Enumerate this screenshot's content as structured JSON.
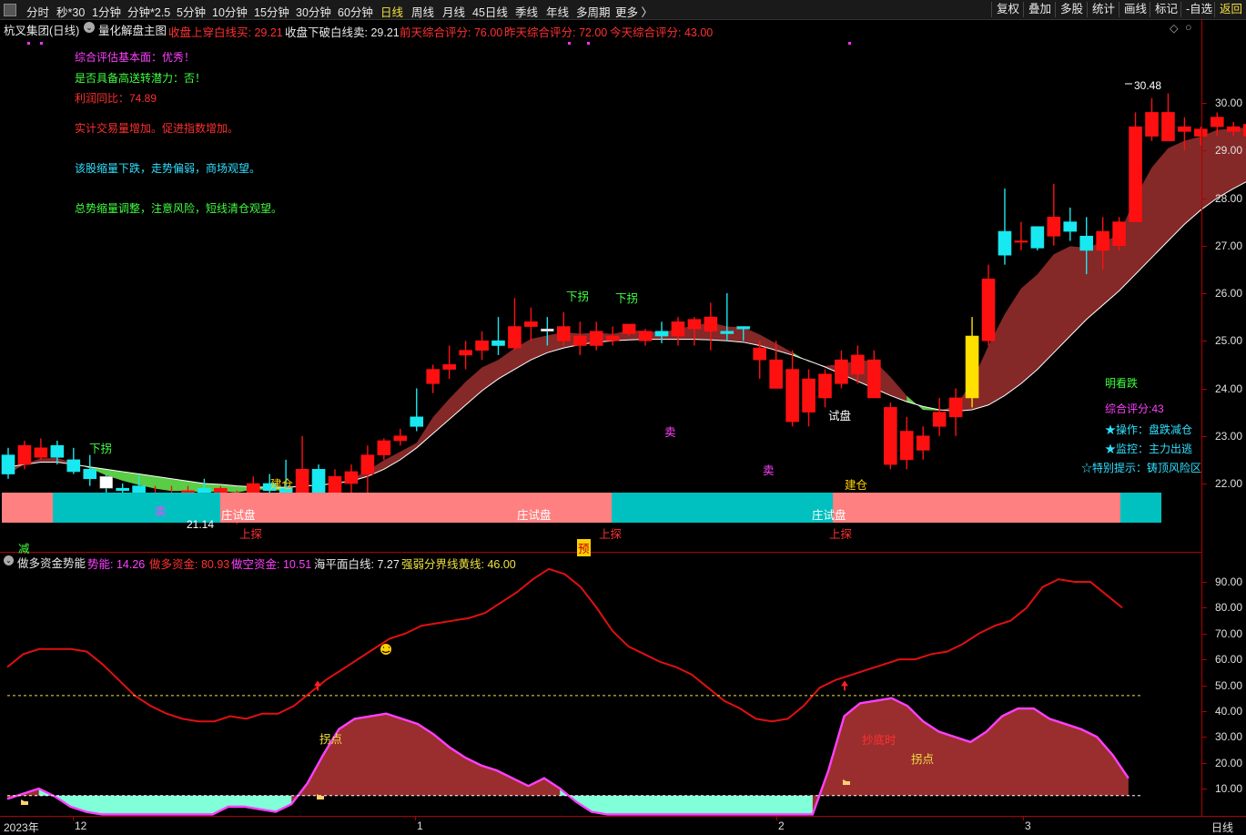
{
  "toolbar": {
    "left_items": [
      "分时",
      "秒*30",
      "1分钟",
      "分钟*2.5",
      "5分钟",
      "10分钟",
      "15分钟",
      "30分钟",
      "60分钟",
      "日线",
      "周线",
      "月线",
      "45日线",
      "季线",
      "年线",
      "多周期",
      "更多 〉"
    ],
    "active": "日线",
    "right_items": [
      "复权",
      "叠加",
      "多股",
      "统计",
      "画线",
      "标记",
      "-自选",
      "返回"
    ]
  },
  "infobar": {
    "stock": "杭叉集团(日线)",
    "indicator_name": "量化解盘主图",
    "items": [
      {
        "text": "收盘上穿白线买: 29.21",
        "color": "#ff3030"
      },
      {
        "text": "收盘下破白线卖: 29.21",
        "color": "#e8e8e8"
      },
      {
        "text": "前天综合评分: 76.00",
        "color": "#ff3030"
      },
      {
        "text": "昨天综合评分: 72.00",
        "color": "#ff3030"
      },
      {
        "text": "今天综合评分: 43.00",
        "color": "#ff3030"
      }
    ]
  },
  "commentary": [
    {
      "text": "综合评估基本面：优秀！",
      "color": "#ff40ff"
    },
    {
      "text": "是否具备高送转潜力：否！",
      "color": "#40ff40"
    },
    {
      "text": "利润同比：74.89",
      "color": "#ff3030"
    },
    {
      "text": "实计交易量增加。促进指数增加。",
      "color": "#ff3030"
    },
    {
      "text": "该股缩量下跌，走势偏弱，商场观望。",
      "color": "#30e0ff"
    },
    {
      "text": "总势缩量调整，注意风险，短线清仓观望。",
      "color": "#40ff40"
    }
  ],
  "side_panel": [
    {
      "text": "明看跌",
      "color": "#40ff40"
    },
    {
      "text": "综合评分:43",
      "color": "#ff40ff"
    },
    {
      "text": "★操作：盘跌减仓",
      "color": "#30e0ff"
    },
    {
      "text": "★监控：主力出逃",
      "color": "#30e0ff"
    },
    {
      "text": "☆特别提示：铸顶风险区",
      "color": "#30e0ff"
    }
  ],
  "price_axis": [
    "30.00",
    "29.00",
    "28.00",
    "27.00",
    "26.00",
    "25.00",
    "24.00",
    "23.00",
    "22.00"
  ],
  "price_marks": {
    "high_label": "30.48",
    "low_label": "21.14"
  },
  "chart_labels": [
    {
      "text": "下拐",
      "color": "#40ff40",
      "kind": "signal"
    },
    {
      "text": "下拐",
      "color": "#40ff40",
      "kind": "signal"
    },
    {
      "text": "下拐",
      "color": "#40ff40",
      "kind": "signal"
    },
    {
      "text": "卖",
      "color": "#ff40ff",
      "kind": "signal"
    },
    {
      "text": "卖",
      "color": "#ff40ff",
      "kind": "signal"
    },
    {
      "text": "卖",
      "color": "#ff40ff",
      "kind": "signal"
    },
    {
      "text": "建仓",
      "color": "#ffd000",
      "kind": "signal"
    },
    {
      "text": "建仓",
      "color": "#ffd000",
      "kind": "signal"
    },
    {
      "text": "试盘",
      "color": "#ffffff",
      "kind": "signal"
    },
    {
      "text": "庄试盘",
      "color": "#ffffff",
      "kind": "band"
    },
    {
      "text": "庄试盘",
      "color": "#ffffff",
      "kind": "band"
    },
    {
      "text": "庄试盘",
      "color": "#ffffff",
      "kind": "band"
    },
    {
      "text": "上探",
      "color": "#ff3030",
      "kind": "signal"
    },
    {
      "text": "上探",
      "color": "#ff3030",
      "kind": "signal"
    },
    {
      "text": "上探",
      "color": "#ff3030",
      "kind": "signal"
    },
    {
      "text": "减",
      "color": "#40ff40",
      "kind": "signal"
    },
    {
      "text": "预",
      "color": "#ff3030",
      "kind": "signal"
    }
  ],
  "indicator": {
    "name": "做多资金势能",
    "items": [
      {
        "text": "势能: 14.26",
        "color": "#ff40ff"
      },
      {
        "text": "做多资金: 80.93",
        "color": "#ff3030"
      },
      {
        "text": "做空资金: 10.51",
        "color": "#ff40ff"
      },
      {
        "text": "海平面白线: 7.27",
        "color": "#e8e8e8"
      },
      {
        "text": "强弱分界线黄线: 46.00",
        "color": "#f0e040"
      }
    ],
    "axis": [
      "90.00",
      "80.00",
      "70.00",
      "60.00",
      "50.00",
      "40.00",
      "30.00",
      "20.00",
      "10.00"
    ],
    "labels": [
      {
        "text": "拐点",
        "color": "#f0e040"
      },
      {
        "text": "拐点",
        "color": "#f0e040"
      },
      {
        "text": "抄底时",
        "color": "#ff3030"
      }
    ]
  },
  "time_axis": [
    "2023年",
    "12",
    "1",
    "2",
    "3"
  ],
  "period_label": "日线",
  "chart_data": {
    "type": "candlestick",
    "title": "杭叉集团(日线)",
    "ylim": [
      21.0,
      31.0
    ],
    "candles": [
      [
        22.6,
        22.2,
        22.75,
        22.1
      ],
      [
        22.4,
        22.8,
        22.9,
        22.3
      ],
      [
        22.55,
        22.75,
        22.95,
        22.5
      ],
      [
        22.8,
        22.55,
        22.9,
        22.4
      ],
      [
        22.5,
        22.25,
        22.75,
        22.2
      ],
      [
        22.3,
        22.1,
        22.6,
        21.95
      ],
      [
        22.15,
        21.9,
        22.2,
        21.8
      ],
      [
        21.9,
        21.85,
        22.0,
        21.7
      ],
      [
        21.95,
        21.8,
        22.15,
        21.75
      ],
      [
        21.7,
        21.75,
        21.95,
        21.55
      ],
      [
        21.7,
        21.75,
        21.95,
        21.6
      ],
      [
        21.75,
        21.85,
        21.95,
        21.65
      ],
      [
        21.9,
        21.75,
        22.1,
        21.6
      ],
      [
        21.65,
        21.9,
        21.95,
        21.35
      ],
      [
        21.7,
        21.75,
        21.85,
        21.15
      ],
      [
        21.75,
        22.0,
        22.15,
        21.55
      ],
      [
        22.0,
        21.85,
        22.2,
        21.7
      ],
      [
        21.9,
        21.8,
        22.5,
        21.75
      ],
      [
        21.8,
        22.3,
        23.0,
        21.7
      ],
      [
        22.3,
        21.8,
        22.4,
        21.7
      ],
      [
        21.8,
        22.15,
        22.3,
        21.7
      ],
      [
        22.0,
        22.25,
        22.4,
        21.75
      ],
      [
        22.2,
        22.6,
        22.8,
        21.8
      ],
      [
        22.6,
        22.9,
        22.95,
        22.5
      ],
      [
        22.9,
        23.0,
        23.15,
        22.8
      ],
      [
        23.4,
        23.2,
        24.0,
        23.1
      ],
      [
        24.1,
        24.4,
        24.5,
        23.9
      ],
      [
        24.4,
        24.5,
        24.9,
        24.2
      ],
      [
        24.7,
        24.8,
        25.0,
        24.4
      ],
      [
        24.8,
        25.0,
        25.2,
        24.6
      ],
      [
        25.0,
        24.9,
        25.5,
        24.7
      ],
      [
        24.85,
        25.3,
        25.9,
        24.8
      ],
      [
        25.3,
        25.4,
        25.7,
        25.0
      ],
      [
        25.2,
        25.25,
        25.5,
        24.9
      ],
      [
        25.0,
        25.3,
        25.6,
        24.9
      ],
      [
        24.9,
        25.1,
        25.4,
        24.7
      ],
      [
        24.9,
        25.2,
        25.4,
        24.8
      ],
      [
        25.0,
        25.1,
        25.3,
        24.9
      ],
      [
        25.15,
        25.35,
        25.3,
        25.1
      ],
      [
        25.0,
        25.2,
        25.25,
        24.9
      ],
      [
        25.2,
        25.1,
        25.4,
        24.95
      ],
      [
        25.1,
        25.4,
        25.5,
        24.9
      ],
      [
        25.25,
        25.45,
        25.5,
        24.9
      ],
      [
        25.2,
        25.5,
        25.8,
        24.8
      ],
      [
        25.2,
        25.15,
        26.0,
        25.0
      ],
      [
        25.3,
        25.25,
        25.3,
        25.0
      ],
      [
        24.6,
        24.85,
        25.0,
        24.2
      ],
      [
        24.0,
        24.6,
        25.0,
        24.0
      ],
      [
        23.3,
        24.4,
        24.8,
        23.2
      ],
      [
        23.5,
        24.2,
        24.4,
        23.2
      ],
      [
        23.8,
        24.3,
        24.4,
        23.6
      ],
      [
        24.1,
        24.6,
        24.8,
        24.0
      ],
      [
        24.3,
        24.7,
        24.9,
        24.1
      ],
      [
        23.8,
        24.6,
        24.8,
        23.8
      ],
      [
        22.4,
        23.6,
        23.7,
        22.3
      ],
      [
        22.5,
        23.1,
        23.4,
        22.3
      ],
      [
        22.7,
        23.0,
        23.2,
        22.5
      ],
      [
        23.2,
        23.5,
        23.8,
        23.0
      ],
      [
        23.4,
        23.8,
        24.0,
        23.0
      ],
      [
        23.8,
        25.1,
        25.5,
        23.6
      ],
      [
        25.0,
        26.3,
        26.6,
        24.9
      ],
      [
        27.3,
        26.8,
        28.2,
        26.6
      ],
      [
        27.1,
        27.1,
        27.5,
        26.9
      ],
      [
        27.4,
        26.95,
        27.2,
        26.9
      ],
      [
        27.2,
        27.6,
        28.3,
        27.0
      ],
      [
        27.5,
        27.3,
        27.8,
        27.1
      ],
      [
        27.2,
        26.9,
        27.6,
        26.4
      ],
      [
        26.9,
        27.3,
        27.6,
        26.5
      ],
      [
        27.0,
        27.5,
        27.6,
        26.9
      ],
      [
        27.5,
        29.5,
        29.8,
        27.5
      ],
      [
        29.3,
        29.8,
        30.1,
        29.2
      ],
      [
        29.2,
        29.8,
        30.2,
        29.3
      ],
      [
        29.4,
        29.5,
        29.7,
        29.0
      ],
      [
        29.3,
        29.45,
        29.5,
        29.1
      ],
      [
        29.5,
        29.7,
        29.8,
        29.3
      ],
      [
        29.4,
        29.5,
        29.6,
        29.3
      ],
      [
        29.3,
        29.55,
        29.7,
        29.2
      ],
      [
        29.2,
        29.8,
        30.0,
        29.0
      ],
      [
        29.2,
        29.8,
        30.5,
        28.7
      ],
      [
        28.0,
        29.2,
        29.2,
        27.9
      ]
    ],
    "long_line": [
      22.35,
      22.4,
      22.45,
      22.45,
      22.4,
      22.35,
      22.3,
      22.25,
      22.2,
      22.15,
      22.1,
      22.05,
      22.0,
      21.98,
      21.95,
      21.93,
      21.92,
      21.92,
      21.94,
      21.97,
      22.0,
      22.05,
      22.15,
      22.3,
      22.5,
      22.75,
      23.05,
      23.35,
      23.65,
      23.95,
      24.2,
      24.4,
      24.6,
      24.75,
      24.85,
      24.92,
      24.97,
      25.0,
      25.02,
      25.03,
      25.03,
      25.03,
      25.03,
      25.02,
      25.0,
      24.97,
      24.9,
      24.8,
      24.7,
      24.58,
      24.45,
      24.3,
      24.15,
      24.0,
      23.85,
      23.72,
      23.62,
      23.55,
      23.52,
      23.55,
      23.65,
      23.85,
      24.1,
      24.4,
      24.75,
      25.1,
      25.45,
      25.75,
      26.05,
      26.4,
      26.75,
      27.1,
      27.45,
      27.75,
      28.0,
      28.2,
      28.38,
      28.52,
      28.63,
      28.72
    ]
  }
}
